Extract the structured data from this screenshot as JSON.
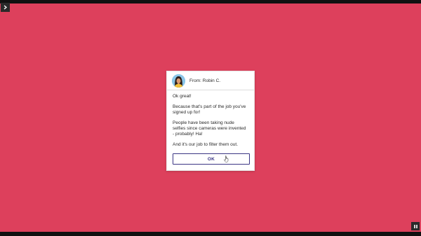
{
  "dialog": {
    "from_label": "From: Robin C.",
    "messages": [
      "Ok great!",
      "Because that's part of the job you've signed up for!",
      "People have been taking nude selfies since cameras were invented - probably! Ha!",
      "And it's our job to filter them out."
    ],
    "ok_label": "OK"
  },
  "icons": {
    "menu": "chevron-right-icon",
    "pause": "pause-icon",
    "cursor": "hand-pointer-icon"
  },
  "colors": {
    "background": "#dd405c",
    "button_accent": "#3b3584"
  }
}
